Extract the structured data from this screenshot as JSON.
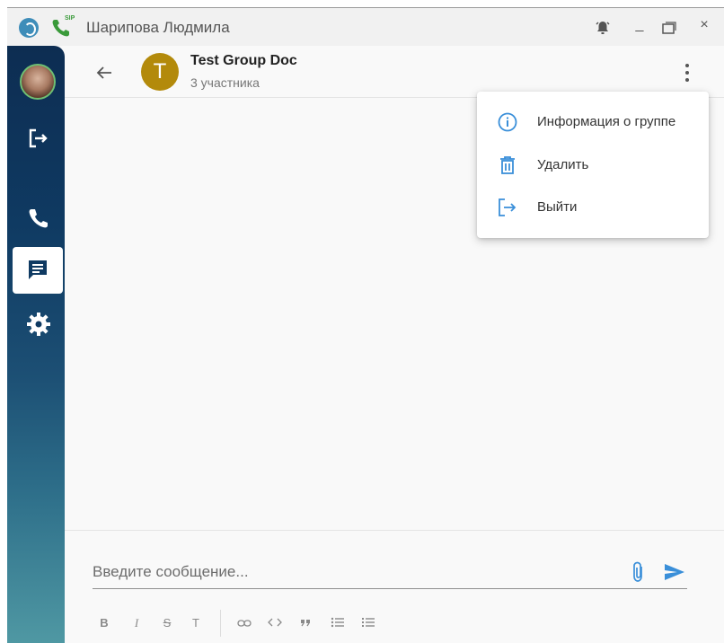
{
  "window": {
    "title": "Шарипова Людмила",
    "sip_badge": "SIP",
    "controls": {
      "minimize": "_",
      "close": "×"
    }
  },
  "chat": {
    "group_initial": "T",
    "group_name": "Test Group Doc",
    "members": "3 участника"
  },
  "menu": {
    "items": [
      {
        "label": "Информация о группе",
        "icon": "info-icon"
      },
      {
        "label": "Удалить",
        "icon": "trash-icon"
      },
      {
        "label": "Выйти",
        "icon": "logout-icon"
      }
    ]
  },
  "composer": {
    "placeholder": "Введите сообщение...",
    "formatting": [
      "B",
      "I",
      "S",
      "T",
      "link",
      "code",
      "quote",
      "bulleted-list",
      "numbered-list"
    ]
  },
  "colors": {
    "accent": "#3a8fd9",
    "group_avatar": "#b38a0b",
    "sidebar_top": "#0d2d52",
    "sidebar_bottom": "#4f98a3"
  }
}
